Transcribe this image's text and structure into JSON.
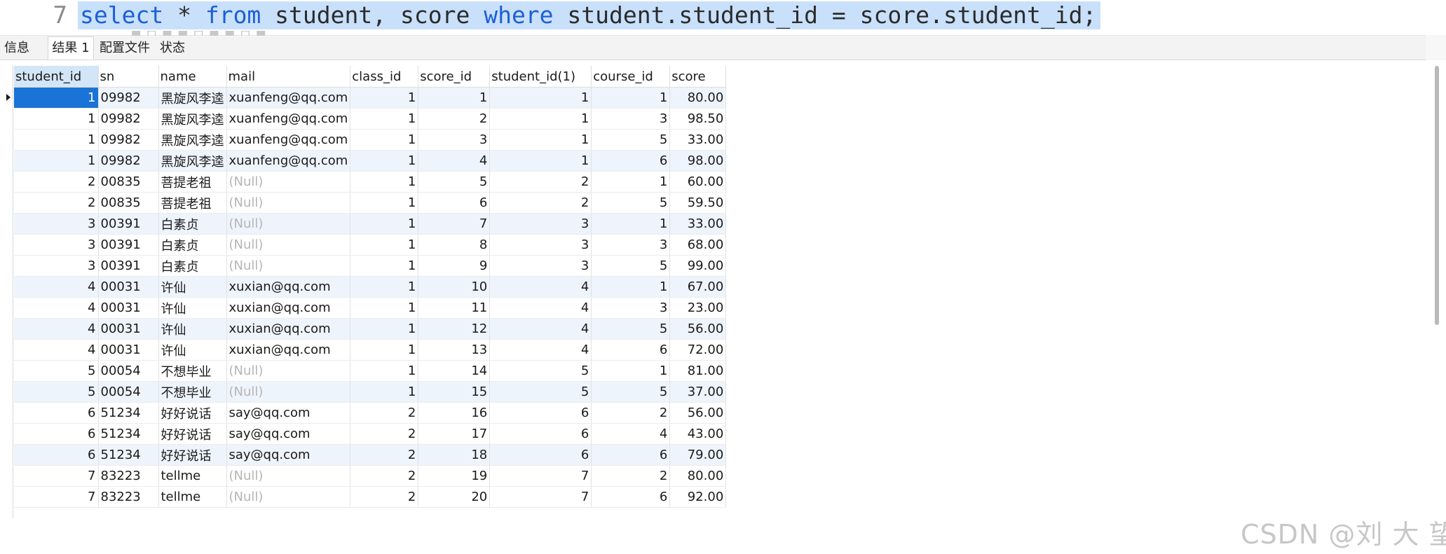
{
  "editor": {
    "line_number": "7",
    "tokens": [
      {
        "t": "select",
        "kw": true
      },
      {
        "t": " * ",
        "kw": false
      },
      {
        "t": "from",
        "kw": true
      },
      {
        "t": " student, score ",
        "kw": false
      },
      {
        "t": "where",
        "kw": true
      },
      {
        "t": " student.student_id = score.student_id;",
        "kw": false
      }
    ]
  },
  "tabs": [
    {
      "label": "信息",
      "active": false
    },
    {
      "label": "结果 1",
      "active": true
    },
    {
      "label": "配置文件",
      "active": false
    },
    {
      "label": "状态",
      "active": false
    }
  ],
  "grid": {
    "columns": [
      "student_id",
      "sn",
      "name",
      "mail",
      "class_id",
      "score_id",
      "student_id(1)",
      "course_id",
      "score"
    ],
    "rows": [
      [
        "1",
        "09982",
        "黑旋风李逵",
        "xuanfeng@qq.com",
        "1",
        "1",
        "1",
        "1",
        "80.00"
      ],
      [
        "1",
        "09982",
        "黑旋风李逵",
        "xuanfeng@qq.com",
        "1",
        "2",
        "1",
        "3",
        "98.50"
      ],
      [
        "1",
        "09982",
        "黑旋风李逵",
        "xuanfeng@qq.com",
        "1",
        "3",
        "1",
        "5",
        "33.00"
      ],
      [
        "1",
        "09982",
        "黑旋风李逵",
        "xuanfeng@qq.com",
        "1",
        "4",
        "1",
        "6",
        "98.00"
      ],
      [
        "2",
        "00835",
        "菩提老祖",
        "(Null)",
        "1",
        "5",
        "2",
        "1",
        "60.00"
      ],
      [
        "2",
        "00835",
        "菩提老祖",
        "(Null)",
        "1",
        "6",
        "2",
        "5",
        "59.50"
      ],
      [
        "3",
        "00391",
        "白素贞",
        "(Null)",
        "1",
        "7",
        "3",
        "1",
        "33.00"
      ],
      [
        "3",
        "00391",
        "白素贞",
        "(Null)",
        "1",
        "8",
        "3",
        "3",
        "68.00"
      ],
      [
        "3",
        "00391",
        "白素贞",
        "(Null)",
        "1",
        "9",
        "3",
        "5",
        "99.00"
      ],
      [
        "4",
        "00031",
        "许仙",
        "xuxian@qq.com",
        "1",
        "10",
        "4",
        "1",
        "67.00"
      ],
      [
        "4",
        "00031",
        "许仙",
        "xuxian@qq.com",
        "1",
        "11",
        "4",
        "3",
        "23.00"
      ],
      [
        "4",
        "00031",
        "许仙",
        "xuxian@qq.com",
        "1",
        "12",
        "4",
        "5",
        "56.00"
      ],
      [
        "4",
        "00031",
        "许仙",
        "xuxian@qq.com",
        "1",
        "13",
        "4",
        "6",
        "72.00"
      ],
      [
        "5",
        "00054",
        "不想毕业",
        "(Null)",
        "1",
        "14",
        "5",
        "1",
        "81.00"
      ],
      [
        "5",
        "00054",
        "不想毕业",
        "(Null)",
        "1",
        "15",
        "5",
        "5",
        "37.00"
      ],
      [
        "6",
        "51234",
        "好好说话",
        "say@qq.com",
        "2",
        "16",
        "6",
        "2",
        "56.00"
      ],
      [
        "6",
        "51234",
        "好好说话",
        "say@qq.com",
        "2",
        "17",
        "6",
        "4",
        "43.00"
      ],
      [
        "6",
        "51234",
        "好好说话",
        "say@qq.com",
        "2",
        "18",
        "6",
        "6",
        "79.00"
      ],
      [
        "7",
        "83223",
        "tellme",
        "(Null)",
        "2",
        "19",
        "7",
        "2",
        "80.00"
      ],
      [
        "7",
        "83223",
        "tellme",
        "(Null)",
        "2",
        "20",
        "7",
        "6",
        "92.00"
      ]
    ],
    "alignment": [
      "num",
      "txt",
      "txt",
      "txt",
      "num",
      "num",
      "num",
      "num",
      "num"
    ],
    "null_text": "(Null)",
    "selected_row": 0,
    "selected_column": 0,
    "alt_rows": [
      0,
      3,
      6,
      9,
      11,
      14,
      17
    ]
  },
  "watermark": "CSDN @刘 大 望",
  "colors": {
    "keyword": "#1c5fd6",
    "selection": "#1a73d6",
    "code_highlight": "#c9e0fb",
    "null_text": "#b5b5b5"
  },
  "icons": [
    "current-row-arrow-icon"
  ]
}
